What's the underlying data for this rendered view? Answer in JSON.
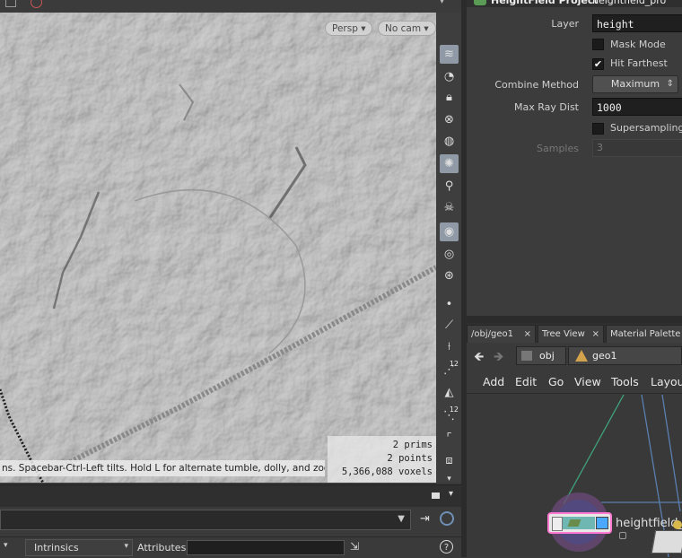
{
  "viewport": {
    "persp_label": "Persp",
    "cam_label": "No cam",
    "hint_text": "ns. Spacebar-Ctrl-Left tilts. Hold L for alternate tumble, dolly, and zoom.",
    "stats": {
      "prims": "2  prims",
      "points": "2 points",
      "voxels": "5,366,088 voxels"
    }
  },
  "toolbar": {
    "icons": [
      "display-options-icon",
      "ghost-icon",
      "lock-icon",
      "xray-icon",
      "shading-icon",
      "light-icon",
      "headlight-icon",
      "skull-icon",
      "bulb-icon",
      "visibility-icon",
      "snapshot-icon",
      "point-icon",
      "vector-icon",
      "normal-icon",
      "count-icon",
      "scene-icon",
      "count2-icon",
      "corner-icon",
      "transform-icon"
    ],
    "badge_12": "12"
  },
  "params": {
    "node_type": "HeightField Project",
    "node_name": "heightfield_pro",
    "layer_label": "Layer",
    "layer_value": "height",
    "mask_mode": "Mask Mode",
    "hit_farthest": "Hit Farthest",
    "combine_label": "Combine Method",
    "combine_value": "Maximum",
    "raydist_label": "Max Ray Dist",
    "raydist_value": "1000",
    "supersampling": "Supersampling",
    "samples_label": "Samples",
    "samples_value": "3"
  },
  "network": {
    "tabs": [
      "/obj/geo1",
      "Tree View",
      "Material Palette"
    ],
    "tab_close": "×",
    "crumb_obj": "obj",
    "crumb_geo": "geo1",
    "menus": [
      "Add",
      "Edit",
      "Go",
      "View",
      "Tools",
      "Layout"
    ],
    "node_label": "heightfield_"
  },
  "bottom": {
    "intrinsics": "Intrinsics",
    "attributes": "Attributes:",
    "help": "?"
  }
}
